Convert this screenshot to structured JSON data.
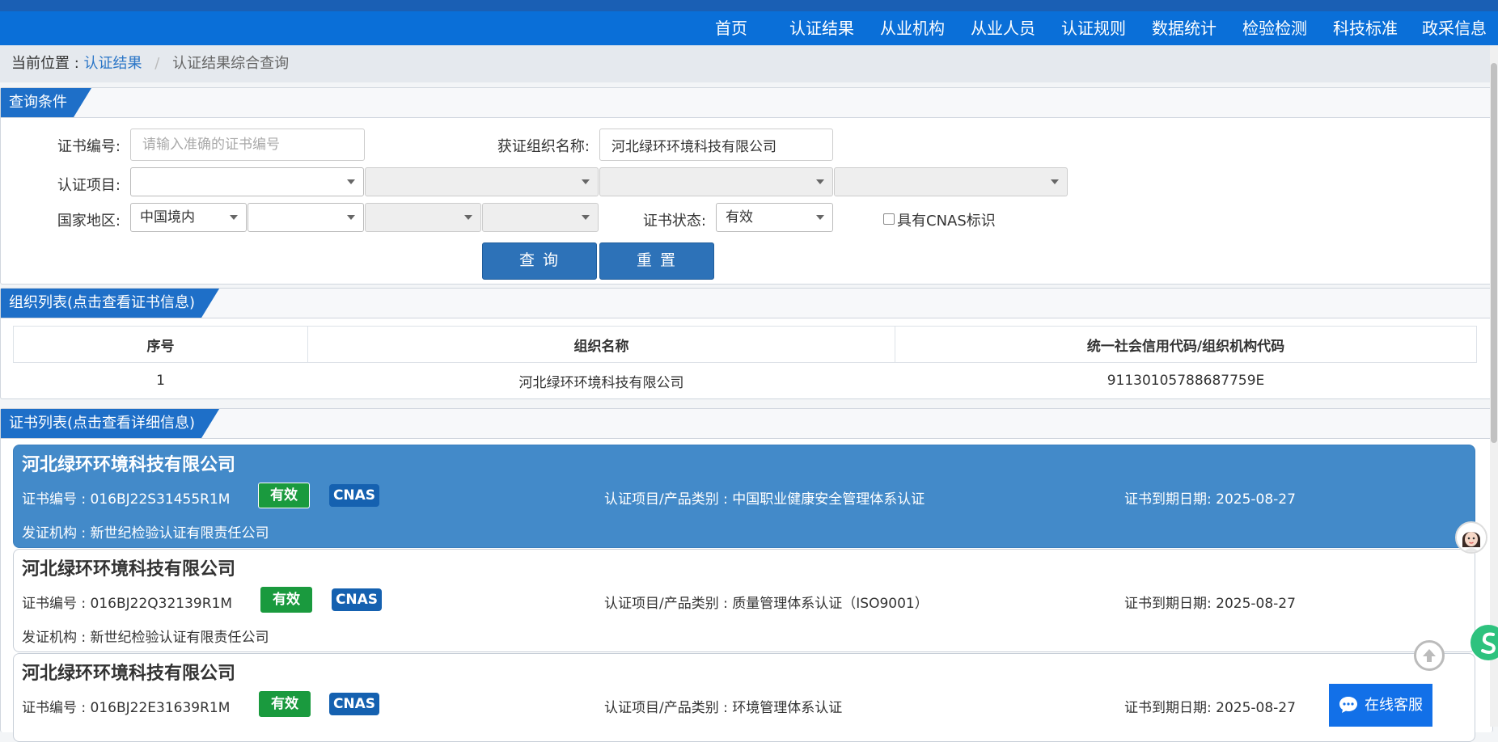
{
  "nav": {
    "items": [
      "首页",
      "认证结果",
      "从业机构",
      "从业人员",
      "认证规则",
      "数据统计",
      "检验检测",
      "科技标准",
      "政采信息"
    ]
  },
  "breadcrumb": {
    "label": "当前位置 :",
    "link": "认证结果",
    "separator": "/",
    "current": "认证结果综合查询"
  },
  "query": {
    "title": "查询条件",
    "cert_no_label": "证书编号:",
    "cert_no_placeholder": "请输入准确的证书编号",
    "org_label": "获证组织名称:",
    "org_value": "河北绿环环境科技有限公司",
    "project_label": "认证项目:",
    "region_label": "国家地区:",
    "region_value": "中国境内",
    "status_label": "证书状态:",
    "status_value": "有效",
    "cnas_checkbox_label": "具有CNAS标识",
    "search_button": "查 询",
    "reset_button": "重 置"
  },
  "org_list": {
    "title": "组织列表(点击查看证书信息)",
    "columns": [
      "序号",
      "组织名称",
      "统一社会信用代码/组织机构代码"
    ],
    "rows": [
      {
        "index": "1",
        "name": "河北绿环环境科技有限公司",
        "code": "91130105788687759E"
      }
    ]
  },
  "cert_list": {
    "title": "证书列表(点击查看详细信息)",
    "cards": [
      {
        "org": "河北绿环环境科技有限公司",
        "cert_no": "证书编号 : 016BJ22S31455R1M",
        "status": "有效",
        "cnas": "CNAS",
        "project": "认证项目/产品类别 : 中国职业健康安全管理体系认证",
        "expiry": "证书到期日期: 2025-08-27",
        "issuer": "发证机构 : 新世纪检验认证有限责任公司"
      },
      {
        "org": "河北绿环环境科技有限公司",
        "cert_no": "证书编号 : 016BJ22Q32139R1M",
        "status": "有效",
        "cnas": "CNAS",
        "project": "认证项目/产品类别 : 质量管理体系认证（ISO9001）",
        "expiry": "证书到期日期: 2025-08-27",
        "issuer": "发证机构 : 新世纪检验认证有限责任公司"
      },
      {
        "org": "河北绿环环境科技有限公司",
        "cert_no": "证书编号 : 016BJ22E31639R1M",
        "status": "有效",
        "cnas": "CNAS",
        "project": "认证项目/产品类别 : 环境管理体系认证",
        "expiry": "证书到期日期: 2025-08-27"
      }
    ]
  },
  "floating": {
    "service_label": "在线客服",
    "service_icon": "chat-bubble-icon",
    "top_icon": "arrow-up-icon",
    "avatar_icon": "customer-service-avatar-icon"
  },
  "colors": {
    "nav_bg": "#0a6fd8",
    "panel_title_bg": "#1e6fc8",
    "active_card_bg": "#438ac9",
    "valid_badge": "#1a9a3e",
    "cnas_badge": "#1561b0",
    "service_bg": "#1270e8"
  }
}
